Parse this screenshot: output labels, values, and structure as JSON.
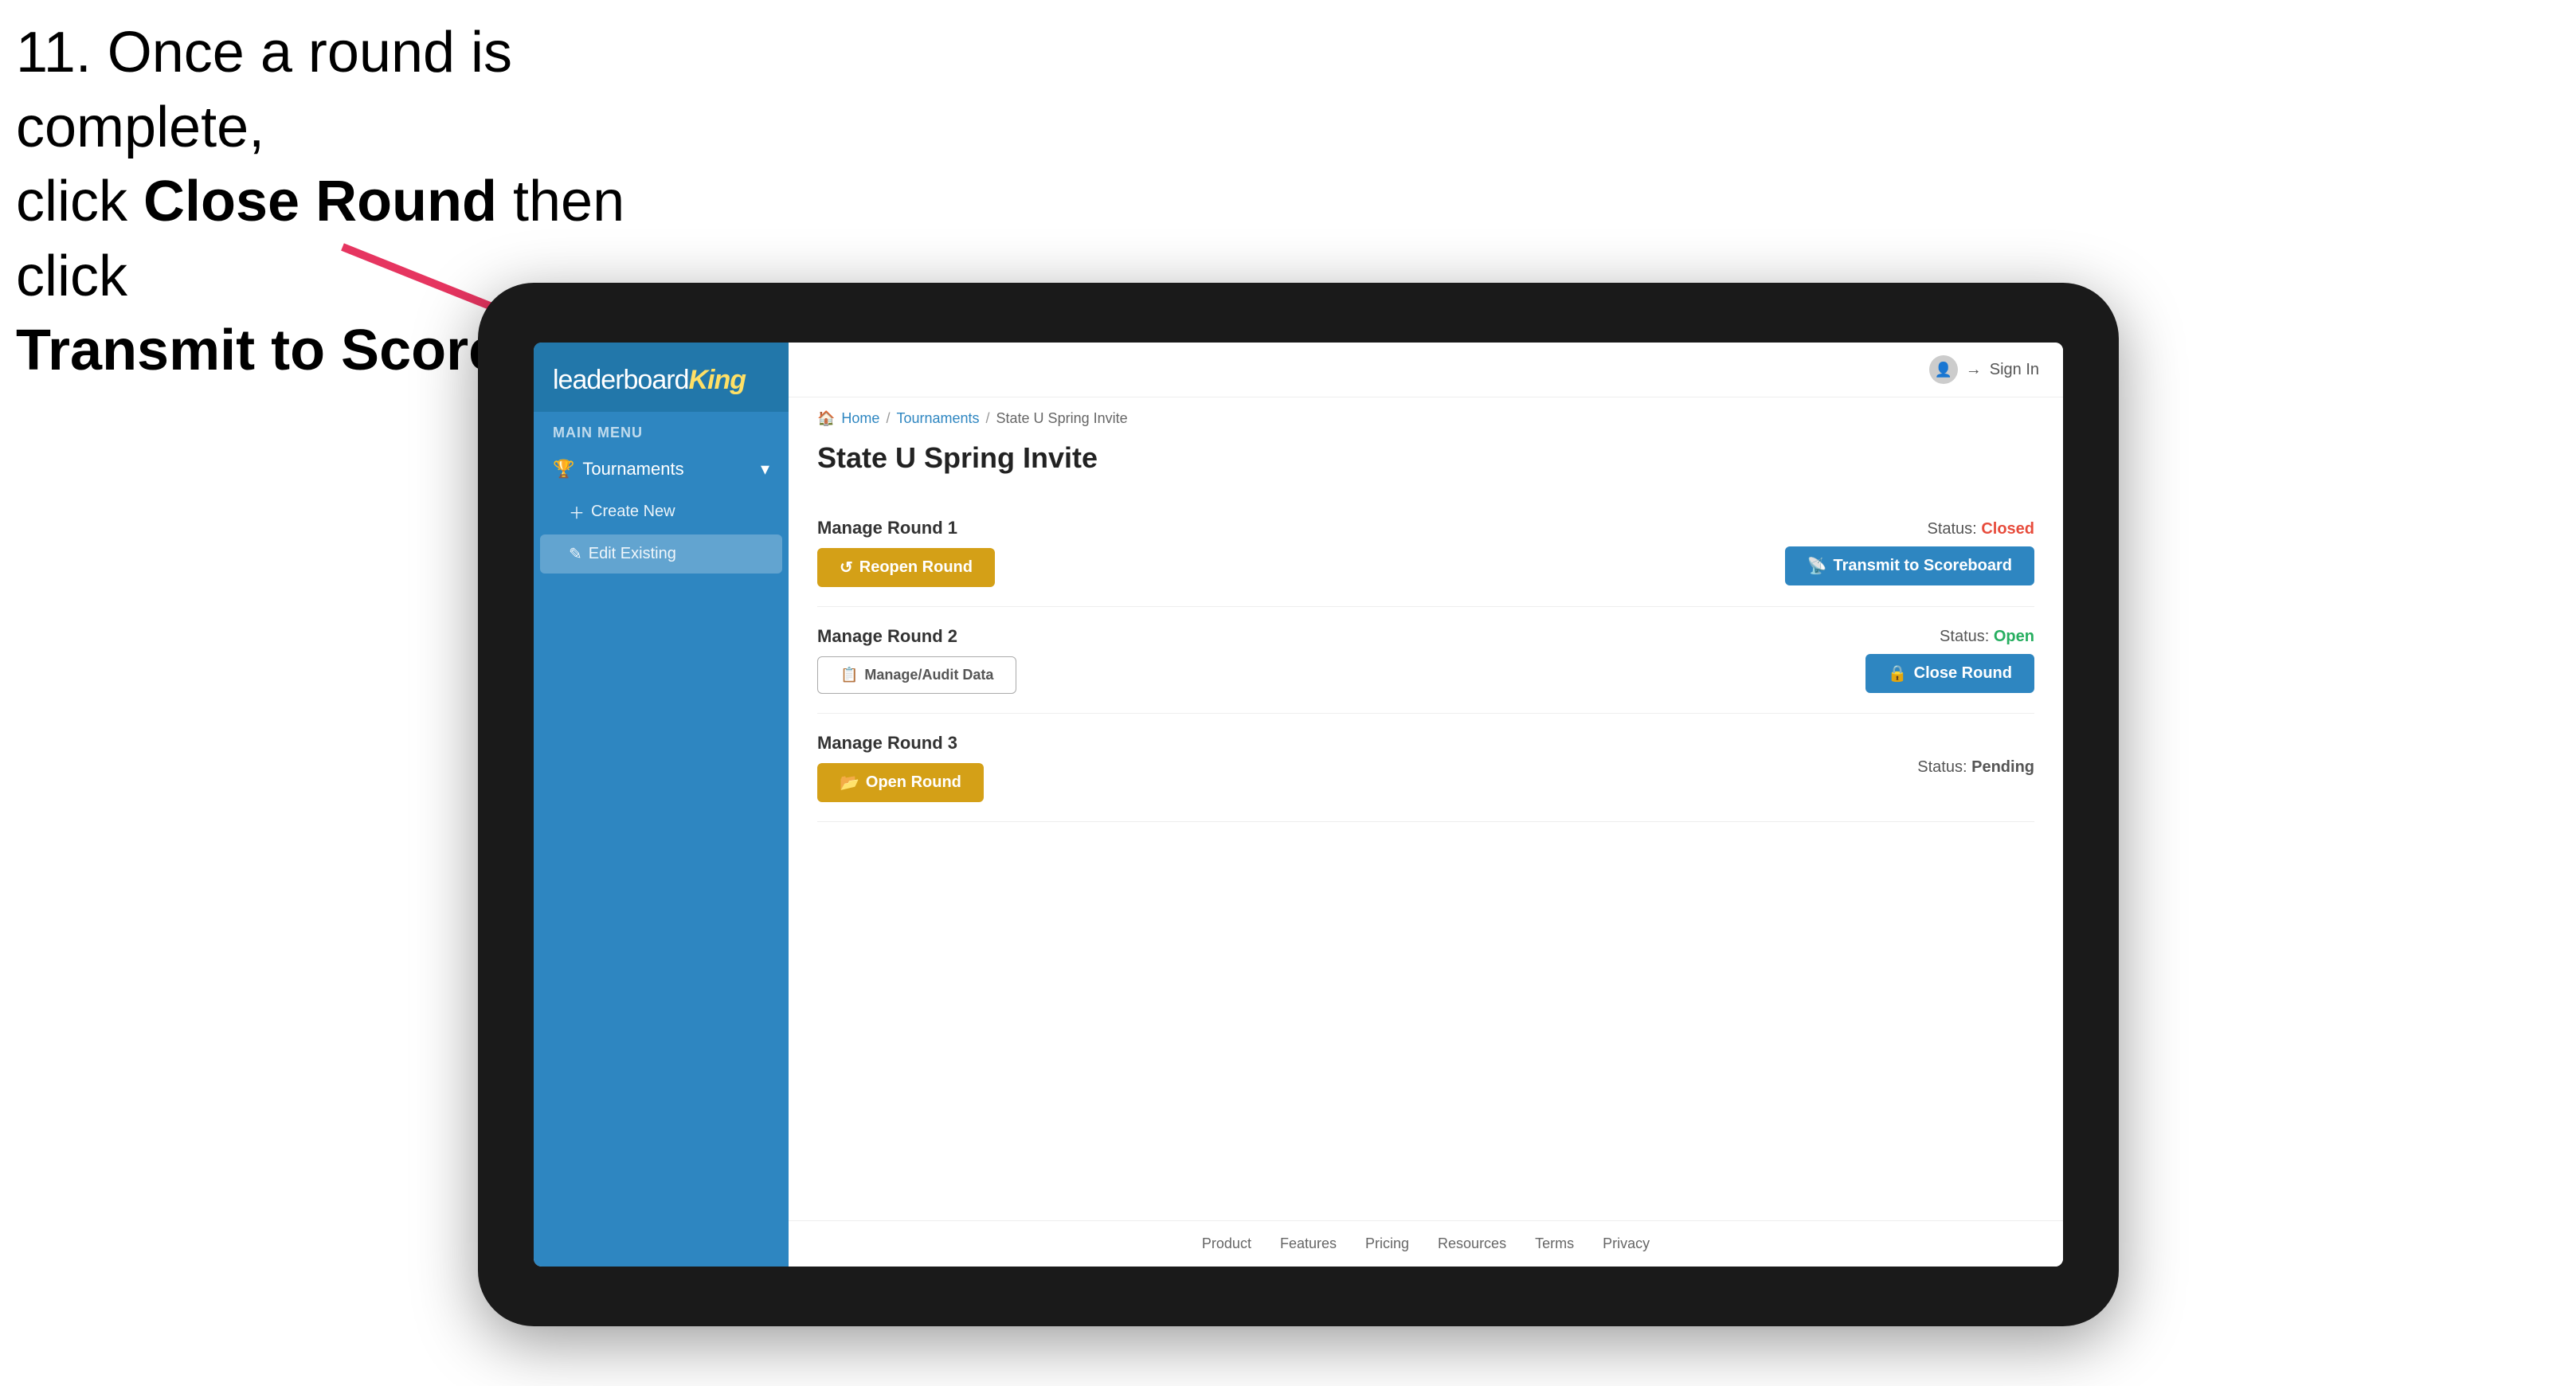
{
  "instruction": {
    "line1": "11. Once a round is complete,",
    "line2": "click ",
    "bold1": "Close Round",
    "line3": " then click",
    "bold2": "Transmit to Scoreboard."
  },
  "logo": {
    "leaderboard": "leaderboard",
    "king": "King"
  },
  "sidebar": {
    "menu_label": "MAIN MENU",
    "tournaments_label": "Tournaments",
    "create_new_label": "Create New",
    "edit_existing_label": "Edit Existing"
  },
  "header": {
    "sign_in": "Sign In"
  },
  "breadcrumb": {
    "home": "Home",
    "sep1": "/",
    "tournaments": "Tournaments",
    "sep2": "/",
    "current": "State U Spring Invite"
  },
  "page": {
    "title": "State U Spring Invite",
    "rounds": [
      {
        "id": "round1",
        "label": "Manage Round 1",
        "status_label": "Status:",
        "status_value": "Closed",
        "status_type": "closed",
        "button1_label": "Reopen Round",
        "button2_label": "Transmit to Scoreboard"
      },
      {
        "id": "round2",
        "label": "Manage Round 2",
        "status_label": "Status:",
        "status_value": "Open",
        "status_type": "open",
        "button1_label": "Manage/Audit Data",
        "button2_label": "Close Round"
      },
      {
        "id": "round3",
        "label": "Manage Round 3",
        "status_label": "Status:",
        "status_value": "Pending",
        "status_type": "pending",
        "button1_label": "Open Round",
        "button2_label": null
      }
    ]
  },
  "footer": {
    "links": [
      "Product",
      "Features",
      "Pricing",
      "Resources",
      "Terms",
      "Privacy"
    ]
  }
}
